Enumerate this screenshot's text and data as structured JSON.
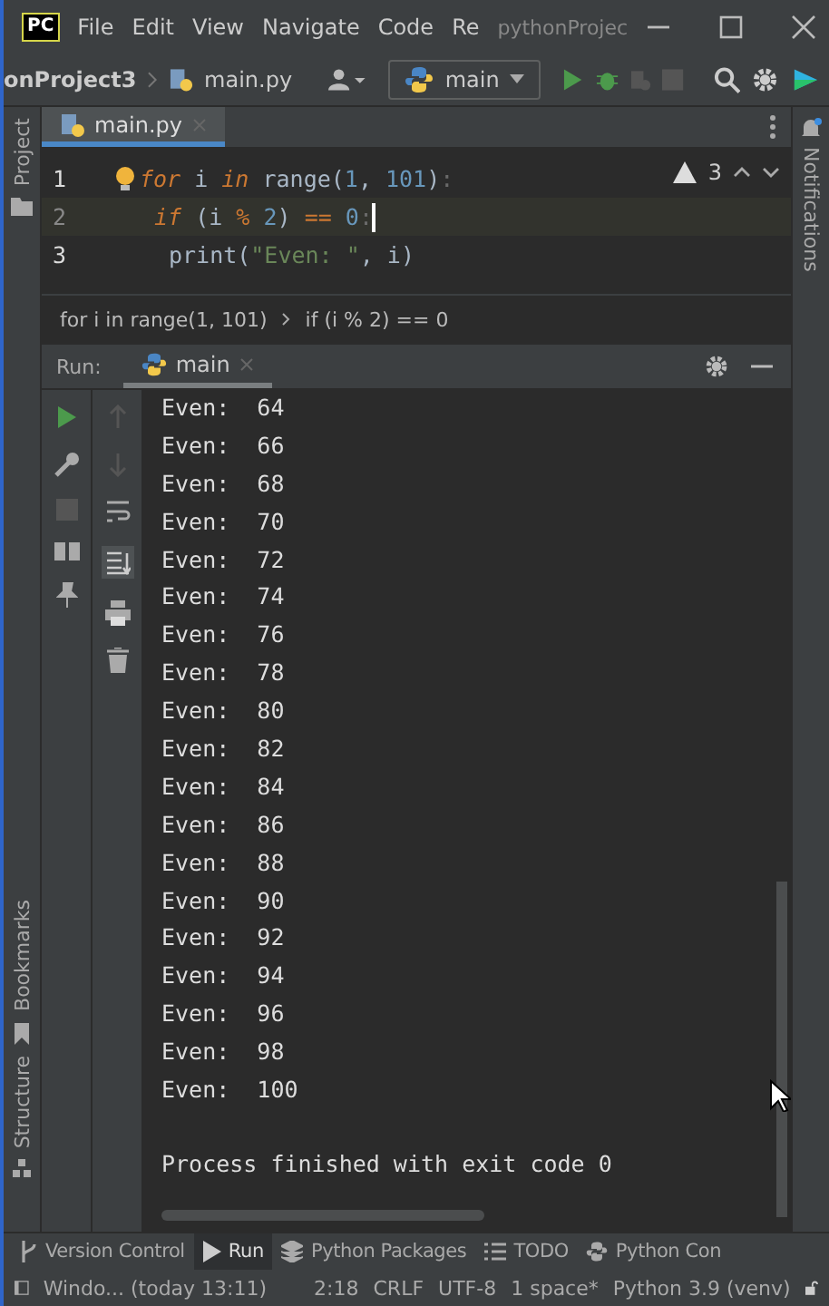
{
  "title_bar": {
    "logo": "PC",
    "menus": [
      "File",
      "Edit",
      "View",
      "Navigate",
      "Code",
      "Re"
    ],
    "project_title": "pythonProjec"
  },
  "nav_bar": {
    "breadcrumbs": [
      "onProject3",
      "main.py"
    ],
    "run_config": "main"
  },
  "left_tool_windows": {
    "top": [
      "Project"
    ],
    "bottom": [
      "Bookmarks",
      "Structure"
    ]
  },
  "right_tool_windows": [
    "Notifications"
  ],
  "editor": {
    "tabs": [
      {
        "label": "main.py",
        "selected": true
      }
    ],
    "lines": [
      {
        "number": "1",
        "current": false,
        "tokens": [
          {
            "kind": "keyword",
            "text": "for"
          },
          {
            "kind": "plain",
            "text": " i "
          },
          {
            "kind": "keyword",
            "text": "in"
          },
          {
            "kind": "plain",
            "text": " range("
          },
          {
            "kind": "number",
            "text": "1"
          },
          {
            "kind": "plain",
            "text": ", "
          },
          {
            "kind": "number",
            "text": "101"
          },
          {
            "kind": "plain",
            "text": ")"
          },
          {
            "kind": "dim",
            "text": ":"
          }
        ]
      },
      {
        "number": "2",
        "current": true,
        "tokens": [
          {
            "kind": "keyword",
            "text": "if"
          },
          {
            "kind": "plain",
            "text": " (i"
          },
          {
            "kind": "operator",
            "text": " %"
          },
          {
            "kind": "number",
            "text": " 2"
          },
          {
            "kind": "plain",
            "text": ") "
          },
          {
            "kind": "operator",
            "text": "=="
          },
          {
            "kind": "number",
            "text": " 0"
          },
          {
            "kind": "dim",
            "text": ":"
          }
        ]
      },
      {
        "number": "3",
        "current": false,
        "tokens": [
          {
            "kind": "plain",
            "text": "print("
          },
          {
            "kind": "string",
            "text": "\"Even: \""
          },
          {
            "kind": "plain",
            "text": ", i)"
          }
        ]
      }
    ],
    "warnings": "3",
    "breadcrumbs": [
      "for i in range(1, 101)",
      "if (i % 2) == 0"
    ]
  },
  "run_panel": {
    "label": "Run:",
    "tabs": [
      {
        "label": "main",
        "selected": true
      }
    ],
    "output": [
      "Even:  64",
      "Even:  66",
      "Even:  68",
      "Even:  70",
      "Even:  72",
      "Even:  74",
      "Even:  76",
      "Even:  78",
      "Even:  80",
      "Even:  82",
      "Even:  84",
      "Even:  86",
      "Even:  88",
      "Even:  90",
      "Even:  92",
      "Even:  94",
      "Even:  96",
      "Even:  98",
      "Even:  100"
    ],
    "exit_message": "Process finished with exit code 0"
  },
  "tool_tabs": [
    {
      "label": "Version Control",
      "selected": false
    },
    {
      "label": "Run",
      "selected": true
    },
    {
      "label": "Python Packages",
      "selected": false
    },
    {
      "label": "TODO",
      "selected": false
    },
    {
      "label": "Python Con",
      "selected": false
    }
  ],
  "status_bar": {
    "message": "Windo... (today 13:11)",
    "items": [
      "2:18",
      "CRLF",
      "UTF-8",
      "1 space*",
      "Python 3.9 (venv)"
    ]
  }
}
